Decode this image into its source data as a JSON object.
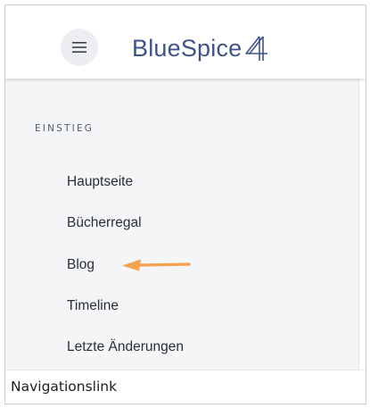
{
  "header": {
    "menu_icon": "hamburger-menu-icon",
    "logo_text": "BlueSpice",
    "logo_mark": "4"
  },
  "sidebar": {
    "section_heading": "EINSTIEG",
    "items": [
      {
        "label": "Hauptseite"
      },
      {
        "label": "Bücherregal"
      },
      {
        "label": "Blog"
      },
      {
        "label": "Timeline"
      },
      {
        "label": "Letzte Änderungen"
      }
    ]
  },
  "annotation": {
    "icon": "arrow-left-icon",
    "color": "#f6a14d"
  },
  "caption": {
    "text": "Navigationslink"
  },
  "colors": {
    "brand": "#3e5389",
    "sidebar_background": "#f4f5f6",
    "menu_button_background": "#eceef2"
  }
}
